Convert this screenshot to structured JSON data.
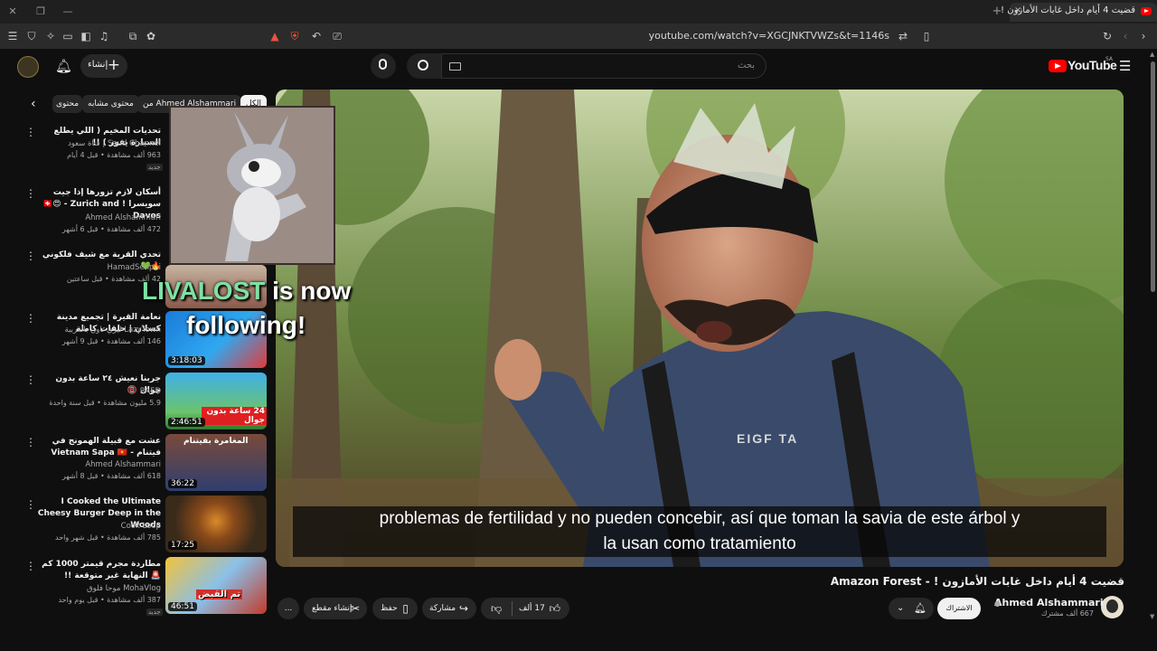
{
  "browser": {
    "tab_title": "قضيت 4 أيام داخل غابات الأمازون !",
    "tab_close": "×",
    "new_tab": "+",
    "url": "youtube.com/watch?v=XGCJNKTVWZs&t=1146s"
  },
  "header": {
    "create_label": "إنشاء",
    "search_placeholder": "بحث",
    "logo_text": "YouTube",
    "region": "SA"
  },
  "chips": [
    {
      "label": "الكل"
    },
    {
      "label": "من Ahmed Alshammari"
    },
    {
      "label": "محتوى مشابه"
    },
    {
      "label": "محتوى"
    }
  ],
  "sidebar": {
    "items": [
      {
        "title": "تحديات المخيم ( اللي يطلع السيارة يفوز ) !!",
        "channel": "Saud Channel | قناة سعود",
        "meta": "963 ألف مشاهدة • قبل 4 أيام",
        "badge": "جديد",
        "duration": ""
      },
      {
        "title": "أسكان لازم تزورها إذا جيت سويسرا ! 🇨🇭😍 - Zurich and Davos",
        "channel": "Ahmed Alshammari",
        "meta": "472 ألف مشاهدة • قبل 6 أشهر",
        "badge": "",
        "duration": ""
      },
      {
        "title": "تحدي القرية مع شيف فلكوني 🔥💚",
        "channel": "HamadSenpai",
        "meta": "42 ألف مشاهدة • قبل ساعتين",
        "badge": "",
        "duration": ""
      },
      {
        "title": "نعامة القيرة | تجميع مدينة كسلان | حلقات كاملة",
        "channel": "LazyTown ليزي تاون بالعربية",
        "meta": "146 ألف مشاهدة • قبل 9 أشهر",
        "badge": "",
        "duration": "3:18:03"
      },
      {
        "title": "جربنا نعيش ٢٤ ساعة بدون جوال 📵",
        "channel": "RAED",
        "meta": "5.9 مليون مشاهدة • قبل سنة واحدة",
        "badge": "",
        "duration": "2:46:51"
      },
      {
        "title": "عشت مع قبيلة الهمونج في فيتنام - Vietnam Sapa 🇻🇳",
        "channel": "Ahmed Alshammari",
        "meta": "618 ألف مشاهدة • قبل 8 أشهر",
        "badge": "",
        "duration": "36:22"
      },
      {
        "title": "I Cooked the Ultimate Cheesy Burger Deep in the Woods",
        "channel": "Cook Loop",
        "meta": "785 ألف مشاهدة • قبل شهر واحد",
        "badge": "",
        "duration": "17:25"
      },
      {
        "title": "مطاردة مجرم قيمتر 1000 كم 🚨 النهاية غير متوقعة !!",
        "channel": "MohaVlog موحا فلوق",
        "meta": "387 ألف مشاهدة • قبل يوم واحد",
        "badge": "جديد",
        "duration": "46:51"
      }
    ],
    "thumb_texts": {
      "raed": "24 ساعة بدون جوال",
      "vietnam": "المغامرة بفيتنام",
      "moha": "تم القبض"
    }
  },
  "overlay": {
    "follower_name": "LIVALOST",
    "follow_text1": " is now",
    "follow_text2": "following!"
  },
  "player": {
    "caption_line1": "problemas de fertilidad y no pueden concebir, así que toman la savia de este árbol y",
    "caption_line2": "la usan como tratamiento",
    "shirt_text": "EIGF TA"
  },
  "video": {
    "title": "قضيت 4 أيام داخل غابات الأمازون ! - Amazon Forest",
    "channel": "Ahmed Alshammari",
    "subscribers": "667 ألف مشترك",
    "subscribe_label": "الاشتراك",
    "likes": "17 ألف",
    "share_label": "مشاركة",
    "save_label": "حفظ",
    "clip_label": "إنشاء مقطع",
    "more": "..."
  },
  "colors": {
    "bg": "#0f0f0f",
    "brand": "#ff0000",
    "chip": "#272727"
  }
}
